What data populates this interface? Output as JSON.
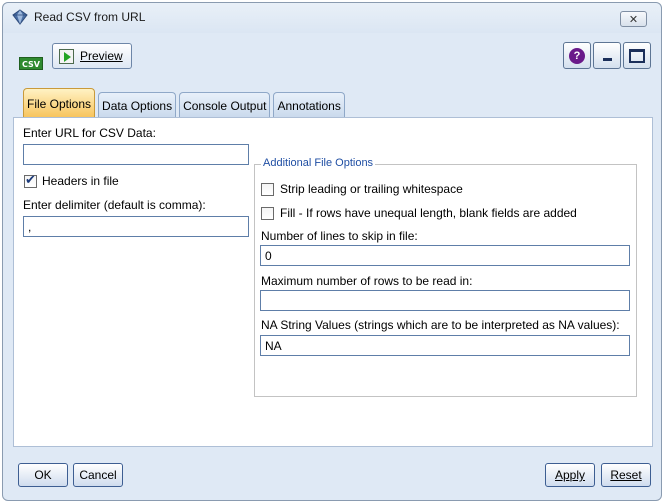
{
  "window": {
    "title": "Read CSV from URL",
    "close_label": "✕"
  },
  "toolbar": {
    "badge": "CSV",
    "preview_label": "Preview",
    "help_label": "?"
  },
  "tabs": [
    {
      "label": "File Options",
      "active": true
    },
    {
      "label": "Data Options",
      "active": false
    },
    {
      "label": "Console Output",
      "active": false
    },
    {
      "label": "Annotations",
      "active": false
    }
  ],
  "file_options": {
    "url_label": "Enter URL for CSV Data:",
    "url_value": "",
    "headers_label": "Headers in file",
    "headers_checked": true,
    "delimiter_label": "Enter delimiter (default is comma):",
    "delimiter_value": ","
  },
  "additional": {
    "title": "Additional File Options",
    "strip_label": "Strip leading or trailing whitespace",
    "strip_checked": false,
    "fill_label": "Fill - If rows have unequal length, blank fields are added",
    "fill_checked": false,
    "skip_label": "Number of lines to skip in file:",
    "skip_value": "0",
    "maxrows_label": "Maximum number of rows to be read in:",
    "maxrows_value": "",
    "na_label": "NA String Values (strings which are to be interpreted as NA values):",
    "na_value": "NA"
  },
  "footer": {
    "ok_label": "OK",
    "cancel_label": "Cancel",
    "apply_label": "Apply",
    "reset_label": "Reset"
  },
  "colors": {
    "active_tab": "#f7c35a",
    "window_bg": "#dfe9f5",
    "group_title": "#1f4ea3"
  }
}
